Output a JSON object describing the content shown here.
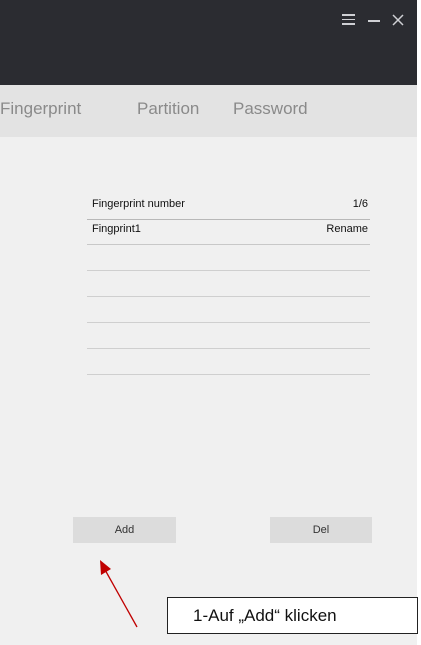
{
  "window": {
    "controls": {
      "menu_icon": "hamburger-icon",
      "minimize_icon": "minimize-icon",
      "close_icon": "close-icon"
    }
  },
  "tabs": [
    {
      "label": "Fingerprint",
      "active": true
    },
    {
      "label": "Partition",
      "active": false
    },
    {
      "label": "Password",
      "active": false
    }
  ],
  "table": {
    "header": {
      "left": "Fingerprint number",
      "right": "1/6"
    },
    "rows": [
      {
        "name": "Fingprint1",
        "action": "Rename"
      }
    ],
    "empty_rows": 5
  },
  "buttons": {
    "add": "Add",
    "del": "Del"
  },
  "annotation": {
    "callout_text": "1-Auf „Add“ klicken",
    "arrow_color": "#c00000"
  },
  "colors": {
    "titlebar": "#2b2c31",
    "tabbar": "#e3e3e3",
    "body": "#f0f0f0",
    "button": "#dcdcdc"
  }
}
